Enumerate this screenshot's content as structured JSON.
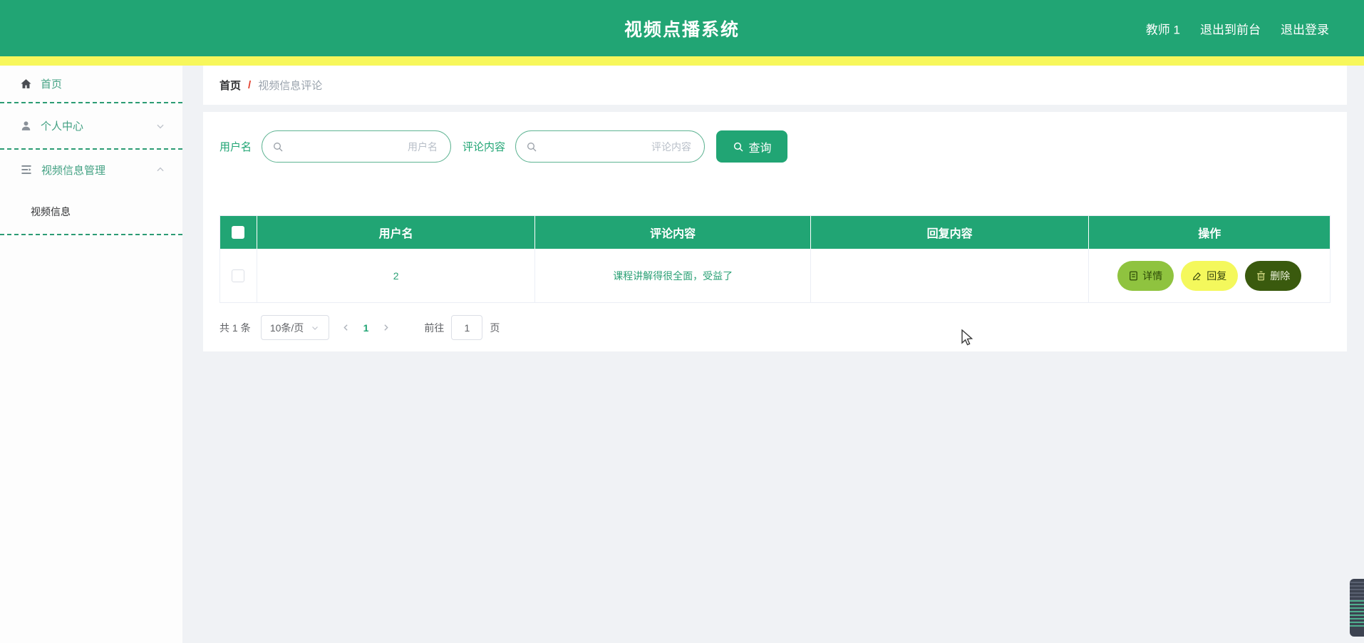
{
  "header": {
    "title": "视频点播系统",
    "user": "教师 1",
    "exit_front": "退出到前台",
    "logout": "退出登录"
  },
  "sidebar": {
    "items": [
      {
        "label": "首页",
        "icon": "home-icon"
      },
      {
        "label": "个人中心",
        "icon": "user-icon",
        "chevron": "down"
      },
      {
        "label": "视频信息管理",
        "icon": "list-icon",
        "chevron": "up"
      }
    ],
    "sub_item": {
      "label": "视频信息"
    }
  },
  "breadcrumb": {
    "home": "首页",
    "separator": "/",
    "current": "视频信息评论"
  },
  "search": {
    "username_label": "用户名",
    "username_placeholder": "用户名",
    "comment_label": "评论内容",
    "comment_placeholder": "评论内容",
    "query_label": "查询"
  },
  "table": {
    "headers": [
      "用户名",
      "评论内容",
      "回复内容",
      "操作"
    ],
    "rows": [
      {
        "username": "2",
        "comment": "课程讲解得很全面，受益了",
        "reply": "",
        "actions": [
          "详情",
          "回复",
          "删除"
        ]
      }
    ]
  },
  "pagination": {
    "total": "共 1 条",
    "page_size": "10条/页",
    "current_page": "1",
    "goto_label": "前往",
    "goto_value": "1",
    "page_label": "页"
  },
  "colors": {
    "theme_green": "#21a574",
    "accent_yellow": "#f7f75b",
    "sidebar_link": "#43a183",
    "breadcrumb_slash": "#e2402e",
    "detail_button": "#8fc33f",
    "reply_button": "#f4f85c",
    "delete_button": "#3a5a0e"
  }
}
